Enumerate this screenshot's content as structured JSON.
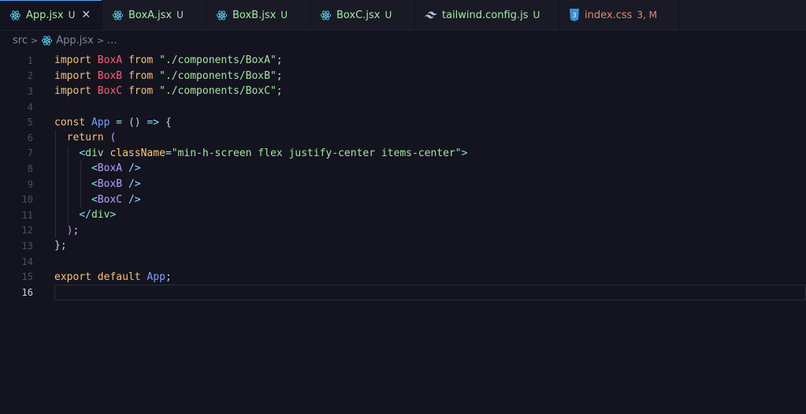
{
  "tabs": [
    {
      "label": "App.jsx",
      "status": "U",
      "icon": "react-icon",
      "active": true
    },
    {
      "label": "BoxA.jsx",
      "status": "U",
      "icon": "react-icon"
    },
    {
      "label": "BoxB.jsx",
      "status": "U",
      "icon": "react-icon"
    },
    {
      "label": "BoxC.jsx",
      "status": "U",
      "icon": "react-icon"
    },
    {
      "label": "tailwind.config.js",
      "status": "U",
      "icon": "tailwind-icon"
    },
    {
      "label": "index.css",
      "status": "3, M",
      "icon": "css-icon"
    }
  ],
  "close_glyph": "✕",
  "breadcrumb": {
    "folder": "src",
    "sep": ">",
    "file": "App.jsx",
    "sep2": ">",
    "more": "..."
  },
  "lines": [
    {
      "n": "1",
      "tokens": [
        [
          "kw",
          "import"
        ],
        [
          "pn",
          " "
        ],
        [
          "im",
          "BoxA"
        ],
        [
          "pn",
          " "
        ],
        [
          "kw",
          "from"
        ],
        [
          "pn",
          " "
        ],
        [
          "str",
          "\"./components/BoxA\""
        ],
        [
          "pn",
          ";"
        ]
      ]
    },
    {
      "n": "2",
      "tokens": [
        [
          "kw",
          "import"
        ],
        [
          "pn",
          " "
        ],
        [
          "im",
          "BoxB"
        ],
        [
          "pn",
          " "
        ],
        [
          "kw",
          "from"
        ],
        [
          "pn",
          " "
        ],
        [
          "str",
          "\"./components/BoxB\""
        ],
        [
          "pn",
          ";"
        ]
      ]
    },
    {
      "n": "3",
      "tokens": [
        [
          "kw",
          "import"
        ],
        [
          "pn",
          " "
        ],
        [
          "im",
          "BoxC"
        ],
        [
          "pn",
          " "
        ],
        [
          "kw",
          "from"
        ],
        [
          "pn",
          " "
        ],
        [
          "str",
          "\"./components/BoxC\""
        ],
        [
          "pn",
          ";"
        ]
      ]
    },
    {
      "n": "4",
      "tokens": []
    },
    {
      "n": "5",
      "tokens": [
        [
          "kw",
          "const"
        ],
        [
          "pn",
          " "
        ],
        [
          "fn",
          "App"
        ],
        [
          "pn",
          " "
        ],
        [
          "punc",
          "="
        ],
        [
          "pn",
          " "
        ],
        [
          "pn",
          "() "
        ],
        [
          "punc",
          "=>"
        ],
        [
          "pn",
          " {"
        ]
      ]
    },
    {
      "n": "6",
      "tokens": [
        [
          "pn",
          "  "
        ],
        [
          "kw",
          "return"
        ],
        [
          "pn",
          " "
        ],
        [
          "tag",
          "("
        ]
      ]
    },
    {
      "n": "7",
      "tokens": [
        [
          "pn",
          "    "
        ],
        [
          "punc",
          "<"
        ],
        [
          "str",
          "div"
        ],
        [
          "pn",
          " "
        ],
        [
          "attr",
          "className"
        ],
        [
          "punc",
          "="
        ],
        [
          "str",
          "\"min-h-screen flex justify-center items-center\""
        ],
        [
          "punc",
          ">"
        ]
      ]
    },
    {
      "n": "8",
      "tokens": [
        [
          "pn",
          "      "
        ],
        [
          "punc",
          "<"
        ],
        [
          "tag",
          "BoxA"
        ],
        [
          "pn",
          " "
        ],
        [
          "punc",
          "/>"
        ]
      ]
    },
    {
      "n": "9",
      "tokens": [
        [
          "pn",
          "      "
        ],
        [
          "punc",
          "<"
        ],
        [
          "tag",
          "BoxB"
        ],
        [
          "pn",
          " "
        ],
        [
          "punc",
          "/>"
        ]
      ]
    },
    {
      "n": "10",
      "tokens": [
        [
          "pn",
          "      "
        ],
        [
          "punc",
          "<"
        ],
        [
          "tag",
          "BoxC"
        ],
        [
          "pn",
          " "
        ],
        [
          "punc",
          "/>"
        ]
      ]
    },
    {
      "n": "11",
      "tokens": [
        [
          "pn",
          "    "
        ],
        [
          "punc",
          "</"
        ],
        [
          "str",
          "div"
        ],
        [
          "punc",
          ">"
        ]
      ]
    },
    {
      "n": "12",
      "tokens": [
        [
          "pn",
          "  "
        ],
        [
          "tag",
          ")"
        ],
        [
          "pn",
          ";"
        ]
      ]
    },
    {
      "n": "13",
      "tokens": [
        [
          "pn",
          "};"
        ]
      ]
    },
    {
      "n": "14",
      "tokens": []
    },
    {
      "n": "15",
      "tokens": [
        [
          "kw",
          "export"
        ],
        [
          "pn",
          " "
        ],
        [
          "kw",
          "default"
        ],
        [
          "pn",
          " "
        ],
        [
          "fn",
          "App"
        ],
        [
          "pn",
          ";"
        ]
      ]
    },
    {
      "n": "16",
      "tokens": [],
      "current": true
    }
  ],
  "colors": {
    "background": "#13141f",
    "keyword": "#f6c177",
    "import_name": "#ff5c7a",
    "string": "#a6e3a1",
    "function": "#7aa2f7",
    "tag": "#c099ff",
    "untracked": "#a9e7a6",
    "modified": "#e28a6b"
  }
}
